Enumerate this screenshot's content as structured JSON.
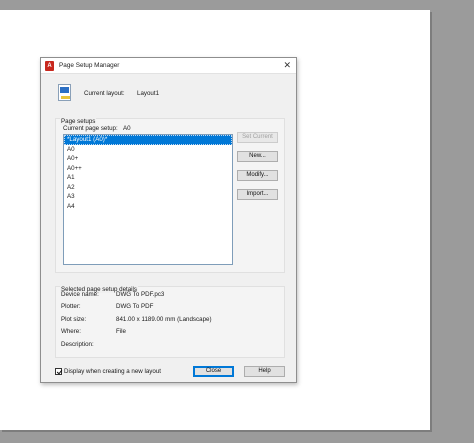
{
  "window": {
    "title": "Page Setup Manager",
    "app_icon": "A",
    "close_glyph": "✕"
  },
  "current_layout": {
    "label": "Current layout:",
    "value": "Layout1"
  },
  "page_setups": {
    "group_title": "Page setups",
    "current_label": "Current page setup:",
    "current_value": "A0",
    "items": [
      "*Layout1 (A0)*",
      "A0",
      "A0+",
      "A0++",
      "A1",
      "A2",
      "A3",
      "A4"
    ],
    "selected_index": 0
  },
  "buttons": {
    "set_current": "Set Current",
    "new": "New...",
    "modify": "Modify...",
    "import": "Import...",
    "close": "Close",
    "help": "Help"
  },
  "details": {
    "group_title": "Selected page setup details",
    "device_name_label": "Device name:",
    "device_name": "DWG To PDF.pc3",
    "plotter_label": "Plotter:",
    "plotter": "DWG To PDF",
    "plot_size_label": "Plot size:",
    "plot_size": "841.00 x 1189.00 mm (Landscape)",
    "where_label": "Where:",
    "where": "File",
    "description_label": "Description:",
    "description": ""
  },
  "footer": {
    "checkbox_label": "Display when creating a new layout",
    "checkbox_checked": true
  },
  "colors": {
    "selection": "#0078d7",
    "title_icon": "#c8281e",
    "backdrop": "#9b9b9b"
  }
}
